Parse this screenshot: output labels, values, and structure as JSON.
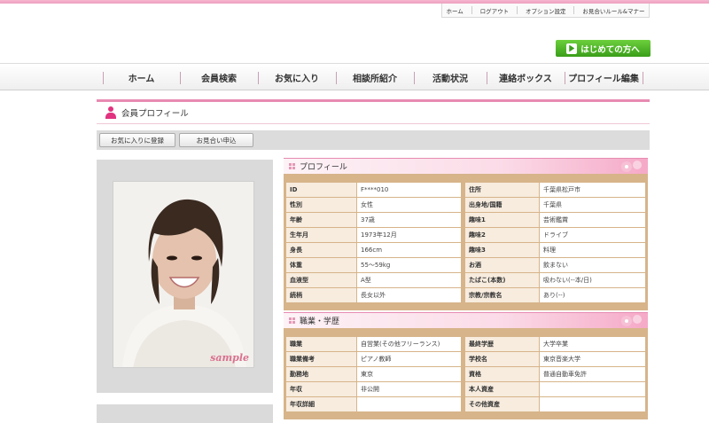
{
  "utility_nav": [
    "ホーム",
    "ログアウト",
    "オプション設定",
    "お見合いルール&マナー"
  ],
  "hajimete_label": "はじめての方へ",
  "main_nav": [
    "ホーム",
    "会員検索",
    "お気に入り",
    "相談所紹介",
    "活動状況",
    "連絡ボックス",
    "プロフィール編集"
  ],
  "page_title": "会員プロフィール",
  "actions": {
    "favorite": "お気に入りに登録",
    "omiai": "お見合い申込"
  },
  "photo": {
    "watermark": "sample"
  },
  "profile": {
    "title": "プロフィール",
    "rows": [
      [
        {
          "k": "ID",
          "v": "F****010"
        },
        {
          "k": "住所",
          "v": "千葉県松戸市"
        }
      ],
      [
        {
          "k": "性別",
          "v": "女性"
        },
        {
          "k": "出身地/国籍",
          "v": "千葉県"
        }
      ],
      [
        {
          "k": "年齢",
          "v": "37歳"
        },
        {
          "k": "趣味1",
          "v": "芸術鑑賞"
        }
      ],
      [
        {
          "k": "生年月",
          "v": "1973年12月"
        },
        {
          "k": "趣味2",
          "v": "ドライブ"
        }
      ],
      [
        {
          "k": "身長",
          "v": "166cm"
        },
        {
          "k": "趣味3",
          "v": "料理"
        }
      ],
      [
        {
          "k": "体重",
          "v": "55～59kg"
        },
        {
          "k": "お酒",
          "v": "飲まない"
        }
      ],
      [
        {
          "k": "血液型",
          "v": "A型"
        },
        {
          "k": "たばこ(本数)",
          "v": "吸わない(--本/日)"
        }
      ],
      [
        {
          "k": "続柄",
          "v": "長女以外"
        },
        {
          "k": "宗教/宗教名",
          "v": "あり(--)"
        }
      ]
    ]
  },
  "career": {
    "title": "職業・学歴",
    "rows": [
      [
        {
          "k": "職業",
          "v": "自営業(その他フリーランス)"
        },
        {
          "k": "最終学歴",
          "v": "大学卒業"
        }
      ],
      [
        {
          "k": "職業備考",
          "v": "ピアノ教師"
        },
        {
          "k": "学校名",
          "v": "東京音楽大学"
        }
      ],
      [
        {
          "k": "勤務地",
          "v": "東京"
        },
        {
          "k": "資格",
          "v": "普通自動車免許"
        }
      ],
      [
        {
          "k": "年収",
          "v": "非公開"
        },
        {
          "k": "本人資産",
          "v": ""
        }
      ],
      [
        {
          "k": "年収詳細",
          "v": ""
        },
        {
          "k": "その他資産",
          "v": ""
        }
      ]
    ]
  },
  "colors": {
    "accent_pink": "#e88ab2",
    "table_border": "#d7b48a",
    "key_bg": "#f7ecde",
    "green_button": "#4cb82a"
  }
}
